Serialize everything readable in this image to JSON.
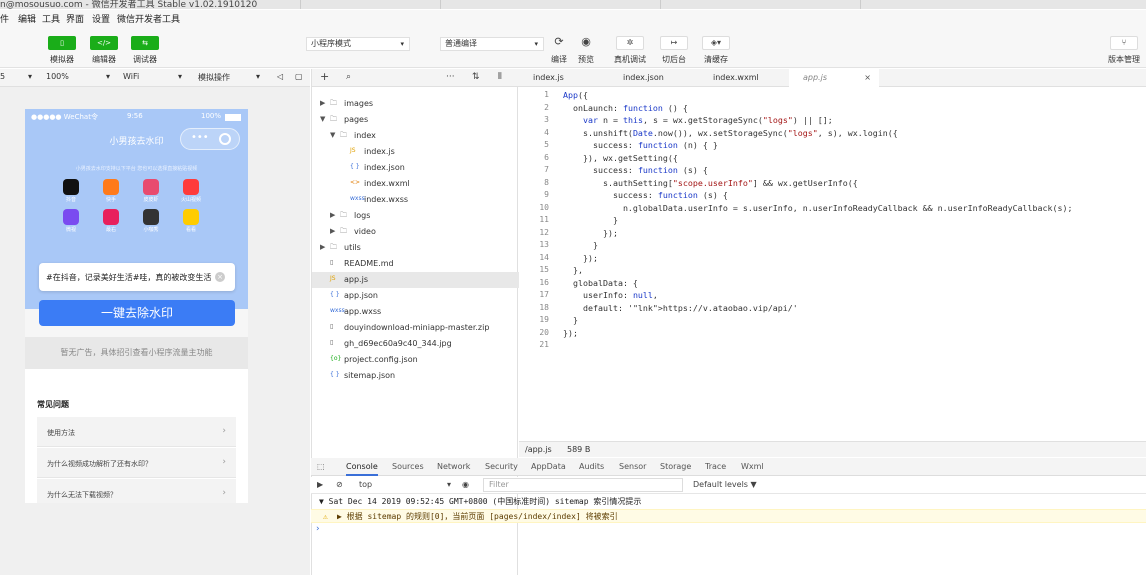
{
  "window": {
    "title": "n@mosousuo.com - 微信开发者工具 Stable v1.02.1910120"
  },
  "menu": [
    "件",
    "编辑",
    "工具",
    "界面",
    "设置",
    "微信开发者工具"
  ],
  "toolbar": {
    "simulator": "模拟器",
    "editor": "编辑器",
    "debugger": "调试器",
    "mode_select": "小程序模式",
    "compile_select": "普通编译",
    "compile": "编译",
    "preview": "预览",
    "remote_debug": "真机调试",
    "cut_background": "切后台",
    "clear_cache": "清缓存",
    "version_mgmt": "版本管理"
  },
  "sim_bar": {
    "scale": "5",
    "zoom": "100%",
    "network": "WiFi",
    "action": "模拟操作"
  },
  "phone": {
    "carrier": "●●●●● WeChat令",
    "time": "9:56",
    "battery": "100%",
    "title": "小男孩去水印",
    "tip": "小男孩去水印支持以下平台 您也可以选择直接粘贴视频",
    "apps": [
      {
        "label": "抖音",
        "color": "#111111"
      },
      {
        "label": "快手",
        "color": "#ff7a1a"
      },
      {
        "label": "皮皮虾",
        "color": "#e84b6f"
      },
      {
        "label": "火山视频",
        "color": "#ff3b3b"
      },
      {
        "label": "微视",
        "color": "#7a4bf0"
      },
      {
        "label": "最右",
        "color": "#e8205c"
      },
      {
        "label": "小咖秀",
        "color": "#333333"
      },
      {
        "label": "看看",
        "color": "#ffcc00"
      }
    ],
    "input_text": "#在抖音，记录美好生活#哇，真的被改变生活",
    "main_button": "一键去除水印",
    "ad_text": "暂无广告，具体招引查看小程序流量主功能",
    "faq_title": "常见问题",
    "faq": [
      "使用方法",
      "为什么视频成功解析了还有水印？",
      "为什么无法下载视频？"
    ]
  },
  "files": [
    {
      "name": "images",
      "type": "folder",
      "depth": 0,
      "open": false
    },
    {
      "name": "pages",
      "type": "folder",
      "depth": 0,
      "open": true
    },
    {
      "name": "index",
      "type": "folder",
      "depth": 1,
      "open": true
    },
    {
      "name": "index.js",
      "type": "js",
      "depth": 2
    },
    {
      "name": "index.json",
      "type": "json",
      "depth": 2
    },
    {
      "name": "index.wxml",
      "type": "wxml",
      "depth": 2
    },
    {
      "name": "index.wxss",
      "type": "wxss",
      "depth": 2
    },
    {
      "name": "logs",
      "type": "folder",
      "depth": 1,
      "open": false
    },
    {
      "name": "video",
      "type": "folder",
      "depth": 1,
      "open": false
    },
    {
      "name": "utils",
      "type": "folder",
      "depth": 0,
      "open": false
    },
    {
      "name": "README.md",
      "type": "file",
      "depth": 0
    },
    {
      "name": "app.js",
      "type": "js",
      "depth": 0,
      "selected": true
    },
    {
      "name": "app.json",
      "type": "json",
      "depth": 0
    },
    {
      "name": "app.wxss",
      "type": "wxss",
      "depth": 0
    },
    {
      "name": "douyindownload-miniapp-master.zip",
      "type": "file",
      "depth": 0
    },
    {
      "name": "gh_d69ec60a9c40_344.jpg",
      "type": "file",
      "depth": 0
    },
    {
      "name": "project.config.json",
      "type": "config",
      "depth": 0
    },
    {
      "name": "sitemap.json",
      "type": "json",
      "depth": 0
    }
  ],
  "editor_tabs": [
    "index.js",
    "index.json",
    "index.wxml",
    "app.js"
  ],
  "code": [
    "App({",
    "  onLaunch: function () {",
    "    var n = this, s = wx.getStorageSync(\"logs\") || [];",
    "    s.unshift(Date.now()), wx.setStorageSync(\"logs\", s), wx.login({",
    "      success: function (n) { }",
    "    }), wx.getSetting({",
    "      success: function (s) {",
    "        s.authSetting[\"scope.userInfo\"] && wx.getUserInfo({",
    "          success: function (s) {",
    "            n.globalData.userInfo = s.userInfo, n.userInfoReadyCallback && n.userInfoReadyCallback(s);",
    "          }",
    "        });",
    "      }",
    "    });",
    "  },",
    "  globalData: {",
    "    userInfo: null,",
    "    default: 'https://v.ataobao.vip/api/'",
    "  }",
    "});",
    ""
  ],
  "pathbar": {
    "path": "/app.js",
    "size": "589 B"
  },
  "devtools": {
    "tabs": [
      "Console",
      "Sources",
      "Network",
      "Security",
      "AppData",
      "Audits",
      "Sensor",
      "Storage",
      "Trace",
      "Wxml"
    ],
    "context": "top",
    "filter_placeholder": "Filter",
    "levels": "Default levels ▼",
    "log_header": "▼ Sat Dec 14 2019 09:52:45 GMT+0800 (中国标准时间) sitemap 索引情况提示",
    "log_warning": "▶ 根据 sitemap 的规则[0]，当前页面 [pages/index/index] 将被索引",
    "prompt": "›"
  }
}
